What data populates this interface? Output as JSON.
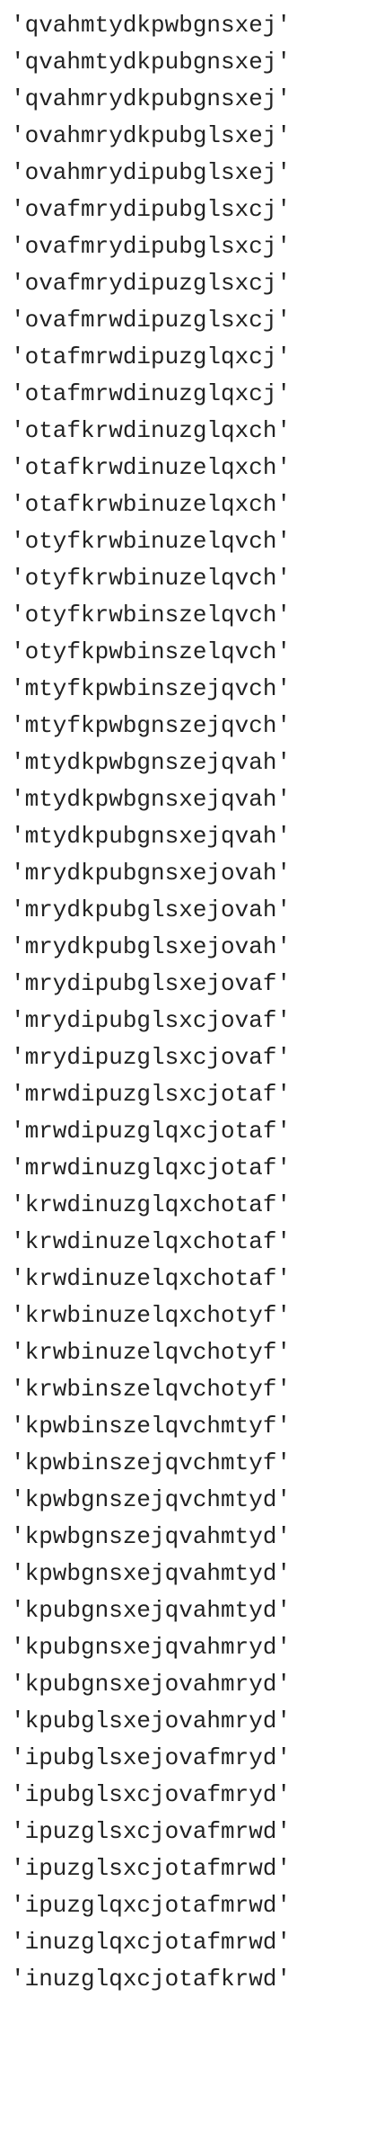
{
  "lines": [
    "'qvahmtydkpwbgnsxej'",
    "'qvahmtydkpubgnsxej'",
    "'qvahmrydkpubgnsxej'",
    "'ovahmrydkpubglsxej'",
    "'ovahmrydipubglsxej'",
    "'ovafmrydipubglsxcj'",
    "'ovafmrydipubglsxcj'",
    "'ovafmrydipuzglsxcj'",
    "'ovafmrwdipuzglsxcj'",
    "'otafmrwdipuzglqxcj'",
    "'otafmrwdinuzglqxcj'",
    "'otafkrwdinuzglqxch'",
    "'otafkrwdinuzelqxch'",
    "'otafkrwbinuzelqxch'",
    "'otyfkrwbinuzelqvch'",
    "'otyfkrwbinuzelqvch'",
    "'otyfkrwbinszelqvch'",
    "'otyfkpwbinszelqvch'",
    "'mtyfkpwbinszejqvch'",
    "'mtyfkpwbgnszejqvch'",
    "'mtydkpwbgnszejqvah'",
    "'mtydkpwbgnsxejqvah'",
    "'mtydkpubgnsxejqvah'",
    "'mrydkpubgnsxejovah'",
    "'mrydkpubglsxejovah'",
    "'mrydkpubglsxejovah'",
    "'mrydipubglsxejovaf'",
    "'mrydipubglsxcjovaf'",
    "'mrydipuzglsxcjovaf'",
    "'mrwdipuzglsxcjotaf'",
    "'mrwdipuzglqxcjotaf'",
    "'mrwdinuzglqxcjotaf'",
    "'krwdinuzglqxchotaf'",
    "'krwdinuzelqxchotaf'",
    "'krwdinuzelqxchotaf'",
    "'krwbinuzelqxchotyf'",
    "'krwbinuzelqvchotyf'",
    "'krwbinszelqvchotyf'",
    "'kpwbinszelqvchmtyf'",
    "'kpwbinszejqvchmtyf'",
    "'kpwbgnszejqvchmtyd'",
    "'kpwbgnszejqvahmtyd'",
    "'kpwbgnsxejqvahmtyd'",
    "'kpubgnsxejqvahmtyd'",
    "'kpubgnsxejqvahmryd'",
    "'kpubgnsxejovahmryd'",
    "'kpubglsxejovahmryd'",
    "'ipubglsxejovafmryd'",
    "'ipubglsxcjovafmryd'",
    "'ipuzglsxcjovafmrwd'",
    "'ipuzglsxcjotafmrwd'",
    "'ipuzglqxcjotafmrwd'",
    "'inuzglqxcjotafmrwd'",
    "'inuzglqxcjotafkrwd'"
  ]
}
